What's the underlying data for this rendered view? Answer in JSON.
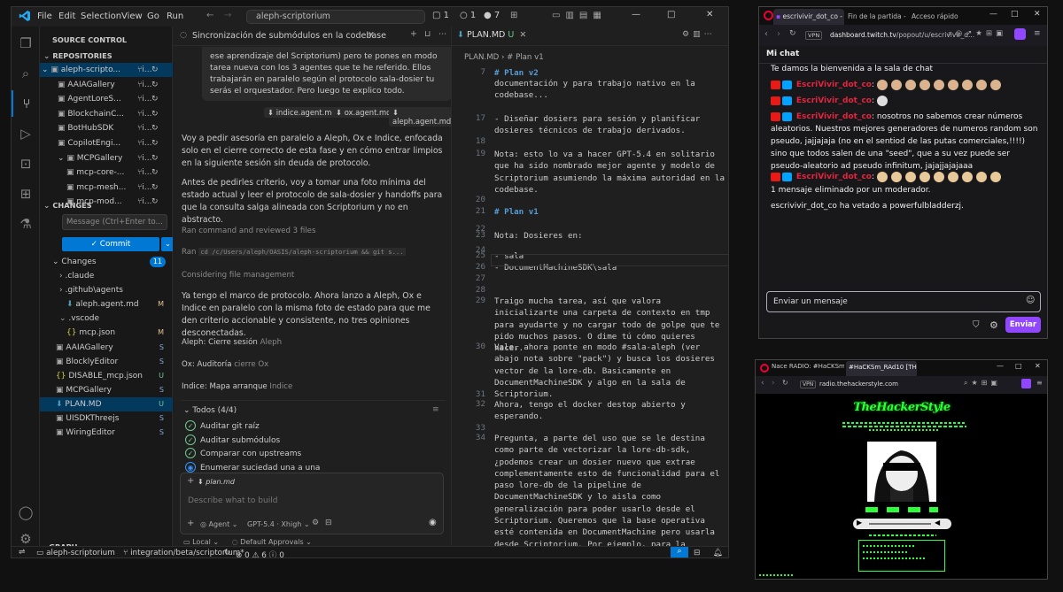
{
  "vscode": {
    "menu": [
      "File",
      "Edit",
      "Selection",
      "View",
      "Go",
      "Run"
    ],
    "search": "aleph-scriptorium",
    "title_counts": [
      "1",
      "1",
      "7"
    ],
    "sidebar": {
      "title": "SOURCE CONTROL",
      "repos_header": "Repositories",
      "repos": [
        {
          "label": "aleph-scripto...",
          "suffix": "i..."
        },
        {
          "label": "AAIAGallery",
          "suffix": "i..."
        },
        {
          "label": "AgentLoreS...",
          "suffix": "i..."
        },
        {
          "label": "BlockchainC...",
          "suffix": "i..."
        },
        {
          "label": "BotHubSDK",
          "suffix": "i..."
        },
        {
          "label": "CopilotEngi...",
          "suffix": "i..."
        },
        {
          "label": "MCPGallery",
          "suffix": "i..."
        },
        {
          "label": "mcp-core-...",
          "suffix": "i..."
        },
        {
          "label": "mcp-mesh...",
          "suffix": "i..."
        },
        {
          "label": "mcp-mod...",
          "suffix": "i..."
        }
      ],
      "changes_header": "Changes",
      "message_placeholder": "Message (Ctrl+Enter to...",
      "commit_label": "Commit",
      "changes_label": "Changes",
      "changes_count": "11",
      "files": [
        {
          "name": ".claude",
          "status": ""
        },
        {
          "name": ".github\\agents",
          "status": ""
        },
        {
          "name": "aleph.agent.md",
          "status": "M"
        },
        {
          "name": ".vscode",
          "status": ""
        },
        {
          "name": "mcp.json",
          "status": "M"
        },
        {
          "name": "AAIAGallery",
          "status": "S"
        },
        {
          "name": "BlocklyEditor",
          "status": "S"
        },
        {
          "name": "DISABLE_mcp.json",
          "status": "U"
        },
        {
          "name": "MCPGallery",
          "status": "S"
        },
        {
          "name": "PLAN.MD",
          "status": "U"
        },
        {
          "name": "UISDKThreejs",
          "status": "S"
        },
        {
          "name": "WiringEditor",
          "status": "S"
        }
      ],
      "graph_label": "GRAPH"
    },
    "chat": {
      "title": "Sincronización de submódulos en la codebase",
      "quote": "ese aprendizaje del Scriptorium) pero te pones en modo tarea nueva con los 3 agentes que te he referido. Ellos trabajarán en paralelo según el protocolo sala-dosier tu serás el orquestador. Pero luego te explico todo.",
      "refs": [
        "indice.agent.md",
        "ox.agent.md",
        "aleph.agent.md"
      ],
      "p1": "Voy a pedir asesoría en paralelo a Aleph, Ox e Indice, enfocada solo en el cierre correcto de esta fase y en cómo entrar limpios en la siguiente sesión sin deuda de protocolo.",
      "p2": "Antes de pedirles criterio, voy a tomar una foto mínima del estado actual y leer el protocolo de sala-dosier y handoffs para que la consulta salga alineada con Scriptorium y no en abstracto.",
      "ran1_a": "Ran",
      "ran1_b": "command and reviewed 3 files",
      "ran2_a": "Ran",
      "ran2_b": "cd /c/Users/aleph/OASIS/aleph-scriptorium && git s...",
      "considering_a": "Considering",
      "considering_b": "file management",
      "p3": "Ya tengo el marco de protocolo. Ahora lanzo a Aleph, Ox e Indice en paralelo con la misma foto de estado para que me den criterio accionable y consistente, no tres opiniones desconectadas.",
      "agent1_a": "Aleph: Cierre sesión",
      "agent1_b": "Aleph",
      "agent2_a": "Ox: Auditoría",
      "agent2_b": "cierre Ox",
      "agent3_a": "Indice: Mapa arranque",
      "agent3_b": "Indice",
      "todos_title": "Todos (4/4)",
      "todos": [
        {
          "label": "Auditar git raíz",
          "done": true
        },
        {
          "label": "Auditar submódulos",
          "done": true
        },
        {
          "label": "Comparar con upstreams",
          "done": true
        },
        {
          "label": "Enumerar suciedad una a una",
          "done": false
        }
      ],
      "attachment": "plan.md",
      "input_placeholder": "Describe what to build",
      "mode": "Agent",
      "model": "GPT-5.4 · Xhigh",
      "local": "Local",
      "approvals": "Default Approvals"
    },
    "editor": {
      "tab": "PLAN.MD",
      "tab_status": "U",
      "breadcrumb_file": "PLAN.MD",
      "breadcrumb_section": "# Plan v1",
      "lines": [
        {
          "n": "7",
          "text": "# Plan v2",
          "hd": true
        },
        {
          "n": "",
          "text": "documentación y para trabajo nativo en la codebase...",
          "hd": false
        },
        {
          "n": "17",
          "text": "- Diseñar dosiers para sesión y planificar dosieres técnicos de trabajo derivados.",
          "hd": false
        },
        {
          "n": "18",
          "text": "",
          "hd": false
        },
        {
          "n": "19",
          "text": "Nota: esto lo va a hacer GPT-5.4 en solitario que ha sido nombrado mejor agente y modelo de Scriptorium asumiendo la máxima autoridad en la codebase.",
          "hd": false
        },
        {
          "n": "20",
          "text": "",
          "hd": false
        },
        {
          "n": "21",
          "text": "# Plan v1",
          "hd": true
        },
        {
          "n": "22",
          "text": "",
          "hd": false
        },
        {
          "n": "23",
          "text": "Nota: Dosieres en:",
          "hd": false
        },
        {
          "n": "24",
          "text": "",
          "hd": false
        },
        {
          "n": "25",
          "text": "- sala",
          "hd": false
        },
        {
          "n": "26",
          "text": "- DocumentMachineSDK\\sala",
          "hd": false
        },
        {
          "n": "27",
          "text": "",
          "hd": false
        },
        {
          "n": "28",
          "text": "",
          "hd": false
        },
        {
          "n": "29",
          "text": "Traigo mucha tarea, así que valora inicializarte una carpeta de contexto en tmp para ayudarte y no cargar todo de golpe que te pido muchos pasos. O dime tú cómo quieres hacer.",
          "hd": false
        },
        {
          "n": "30",
          "text": "Vale, ahora ponte en modo #sala-aleph (ver abajo nota sobre \"pack\") y busca los dosieres vector de la lore-db. Basicamente en DocumentMachineSDK y algo en la sala de Scriptorium.",
          "hd": false
        },
        {
          "n": "31",
          "text": "",
          "hd": false
        },
        {
          "n": "32",
          "text": "Ahora, tengo el docker destop abierto y esperando.",
          "hd": false
        },
        {
          "n": "33",
          "text": "",
          "hd": false
        },
        {
          "n": "34",
          "text": "Pregunta, a parte del uso que se le destina como parte de vectorizar la lore-db-sdk, ¿podemos crear un dosier nuevo que extrae complementamente esto de funcionalidad para el paso lore-db de la pipeline de DocumentMachineSDK y lo aisla como generalización para poder usarlo desde el Scriptorium. Queremos que la base operativa esté contenida en DocumentMachine pero usarla desde Scriptorium. Por ejemplo, para la siguiente propuesta:",
          "hd": false
        },
        {
          "n": "35",
          "text": "",
          "hd": false
        }
      ]
    },
    "status": {
      "repo": "aleph-scriptorium",
      "branch": "integration/beta/scriptorium*",
      "errors": "0",
      "warnings": "6",
      "info": "0"
    }
  },
  "twitch": {
    "tabs": [
      "escrivivir_dot_co - Chat -",
      "Fin de la partida - Ju",
      "Acceso rápido"
    ],
    "url_host": "dashboard.twitch.tv",
    "url_path": "/popout/u/escrivivir_d...",
    "vpn": "VPN",
    "header": "Mi chat",
    "welcome": "Te damos la bienvenida a la sala de chat",
    "username": "EscriVivir_dot_co",
    "msg3": "nosotros no sabemos crear números aleatorios. Nuestros mejores generadores de numeros random son pseudo, jajjajaja (no en el sentiod de las putas comerciales,!!!!) sino que todos salen de una \"seed\", que a su vez puede ser pseudo-aleatorio ad pseudo infinitum, jajajjajajaaa",
    "deleted": "1 mensaje eliminado por un moderador.",
    "banned": "escrivivir_dot_co ha vetado a powerfulbladderzj.",
    "input_placeholder": "Enviar un mensaje",
    "send_label": "Enviar",
    "accent": "#9147ff",
    "name_color": "#e3253f"
  },
  "radio": {
    "tabs": [
      "Nace RADIO: #HaCKSm_R",
      "#HaCKSm_RAd10 [TH"
    ],
    "url": "radio.thehackerstyle.com",
    "vpn": "VPN",
    "logo": "TheHackerStyle",
    "accent": "#00ff41"
  }
}
